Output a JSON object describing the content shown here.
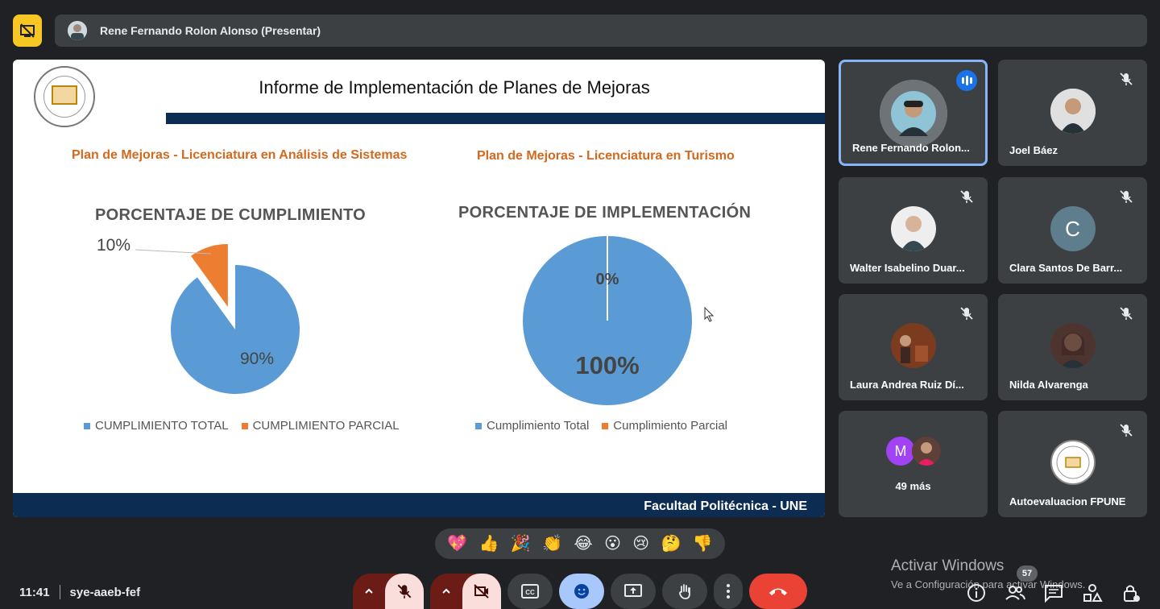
{
  "topbar": {
    "presenter_label": "Rene Fernando Rolon Alonso (Presentar)"
  },
  "slide": {
    "title": "Informe de Implementación de Planes de Mejoras",
    "plan_left": "Plan de Mejoras -  Licenciatura en Análisis de Sistemas",
    "plan_right": "Plan de Mejoras -  Licenciatura en Turismo",
    "footer": "Facultad Politécnica - UNE"
  },
  "chart_data": [
    {
      "type": "pie",
      "title": "PORCENTAJE DE CUMPLIMIENTO",
      "categories": [
        "CUMPLIMIENTO TOTAL",
        "CUMPLIMIENTO PARCIAL"
      ],
      "values": [
        90,
        10
      ],
      "labels": [
        "90%",
        "10%"
      ],
      "colors": [
        "#5b9bd5",
        "#ed7d31"
      ],
      "legend": "bottom"
    },
    {
      "type": "pie",
      "title": "PORCENTAJE DE IMPLEMENTACIÓN",
      "categories": [
        "Cumplimiento Total",
        "Cumplimiento Parcial"
      ],
      "values": [
        100,
        0
      ],
      "labels": [
        "100%",
        "0%"
      ],
      "colors": [
        "#5b9bd5",
        "#ed7d31"
      ],
      "legend": "bottom"
    }
  ],
  "participants": [
    {
      "name": "Rene Fernando Rolon Alonso",
      "display": "Rene Fernando Rolon...",
      "muted": false,
      "speaking": true
    },
    {
      "name": "Joel Báez",
      "display": "Joel Báez",
      "muted": true
    },
    {
      "name": "Walter Isabelino Duarte",
      "display": "Walter Isabelino Duar...",
      "muted": true
    },
    {
      "name": "Clara Santos De Barros",
      "display": "Clara Santos De Barr...",
      "muted": true,
      "initial": "C"
    },
    {
      "name": "Laura Andrea Ruiz Díaz",
      "display": "Laura Andrea Ruiz Dí...",
      "muted": true
    },
    {
      "name": "Nilda Alvarenga",
      "display": "Nilda Alvarenga",
      "muted": true
    },
    {
      "name": "49 más",
      "display": "49 más",
      "initial": "M"
    },
    {
      "name": "Autoevaluacion FPUNE",
      "display": "Autoevaluacion FPUNE",
      "muted": true
    }
  ],
  "reactions": [
    "💖",
    "👍",
    "🎉",
    "👏",
    "😂",
    "😮",
    "😢",
    "🤔",
    "👎"
  ],
  "meeting": {
    "time": "11:41",
    "code": "sye-aaeb-fef",
    "participant_count": "57"
  },
  "watermark": {
    "line1": "Activar Windows",
    "line2": "Ve a Configuración para activar Windows."
  },
  "colors": {
    "accent": "#8ab4f8",
    "end_call": "#ea4335",
    "muted_bg": "#f9dedc",
    "presenting": "#f9c723"
  }
}
